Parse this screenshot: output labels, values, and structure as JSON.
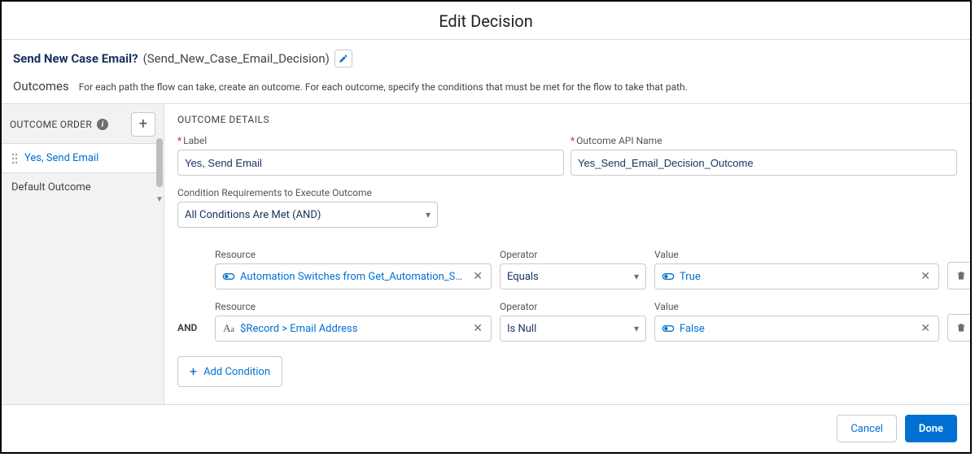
{
  "modal_title": "Edit Decision",
  "decision": {
    "label": "Send New Case Email?",
    "api_name": "(Send_New_Case_Email_Decision)"
  },
  "outcomes_header": {
    "title": "Outcomes",
    "description": "For each path the flow can take, create an outcome. For each outcome, specify the conditions that must be met for the flow to take that path."
  },
  "sidebar": {
    "order_label": "OUTCOME ORDER",
    "items": [
      {
        "label": "Yes, Send Email",
        "selected": true
      },
      {
        "label": "Default Outcome",
        "selected": false
      }
    ]
  },
  "details": {
    "section_title": "OUTCOME DETAILS",
    "label_field": {
      "label": "Label",
      "value": "Yes, Send Email"
    },
    "api_field": {
      "label": "Outcome API Name",
      "value": "Yes_Send_Email_Decision_Outcome"
    },
    "cond_req": {
      "label": "Condition Requirements to Execute Outcome",
      "selected": "All Conditions Are Met (AND)"
    },
    "column_labels": {
      "resource": "Resource",
      "operator": "Operator",
      "value": "Value"
    },
    "rows": [
      {
        "prefix": "",
        "resource_icon": "bool",
        "resource_text": "Automation Switches from Get_Automation_Swit…",
        "operator": "Equals",
        "value_icon": "bool",
        "value_text": "True"
      },
      {
        "prefix": "AND",
        "resource_icon": "text",
        "resource_text": "$Record > Email Address",
        "operator": "Is Null",
        "value_icon": "bool",
        "value_text": "False"
      }
    ],
    "add_condition_label": "Add Condition"
  },
  "footer": {
    "cancel": "Cancel",
    "done": "Done"
  }
}
